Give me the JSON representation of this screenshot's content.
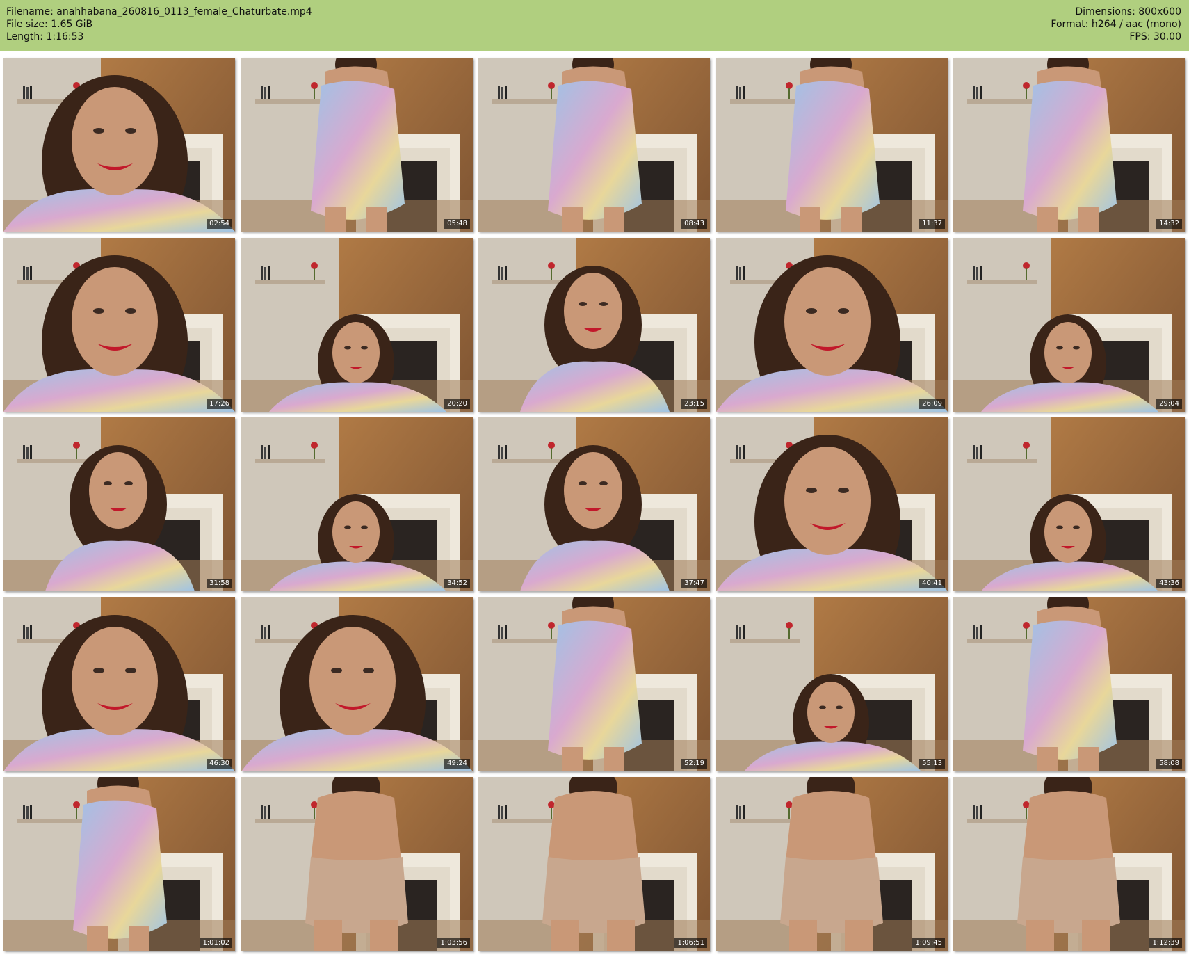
{
  "header": {
    "filename": "Filename: anahhabana_260816_0113_female_Chaturbate.mp4",
    "filesize": "File size: 1.65 GiB",
    "length": "Length: 1:16:53",
    "dimensions": "Dimensions: 800x600",
    "format": "Format: h264 / aac (mono)",
    "fps": "FPS: 30.00",
    "background_color": "#b0cf7f"
  },
  "thumbnails": [
    {
      "timestamp": "02:54",
      "scene": "close-smile"
    },
    {
      "timestamp": "05:48",
      "scene": "standing-robe"
    },
    {
      "timestamp": "08:43",
      "scene": "standing-robe"
    },
    {
      "timestamp": "11:37",
      "scene": "standing-robe"
    },
    {
      "timestamp": "14:32",
      "scene": "standing-robe"
    },
    {
      "timestamp": "17:26",
      "scene": "close-smile"
    },
    {
      "timestamp": "20:20",
      "scene": "seated-low"
    },
    {
      "timestamp": "23:15",
      "scene": "seated-mid"
    },
    {
      "timestamp": "26:09",
      "scene": "close-smile"
    },
    {
      "timestamp": "29:04",
      "scene": "seated-low"
    },
    {
      "timestamp": "31:58",
      "scene": "seated-mid"
    },
    {
      "timestamp": "34:52",
      "scene": "seated-low"
    },
    {
      "timestamp": "37:47",
      "scene": "seated-mid"
    },
    {
      "timestamp": "40:41",
      "scene": "close-smile"
    },
    {
      "timestamp": "43:36",
      "scene": "seated-low"
    },
    {
      "timestamp": "46:30",
      "scene": "close-smile"
    },
    {
      "timestamp": "49:24",
      "scene": "close-smile"
    },
    {
      "timestamp": "52:19",
      "scene": "standing-robe"
    },
    {
      "timestamp": "55:13",
      "scene": "seated-low"
    },
    {
      "timestamp": "58:08",
      "scene": "standing-robe"
    },
    {
      "timestamp": "1:01:02",
      "scene": "standing-robe"
    },
    {
      "timestamp": "1:03:56",
      "scene": "standing-back"
    },
    {
      "timestamp": "1:06:51",
      "scene": "standing-back"
    },
    {
      "timestamp": "1:09:45",
      "scene": "standing-back"
    },
    {
      "timestamp": "1:12:39",
      "scene": "standing-back"
    }
  ]
}
